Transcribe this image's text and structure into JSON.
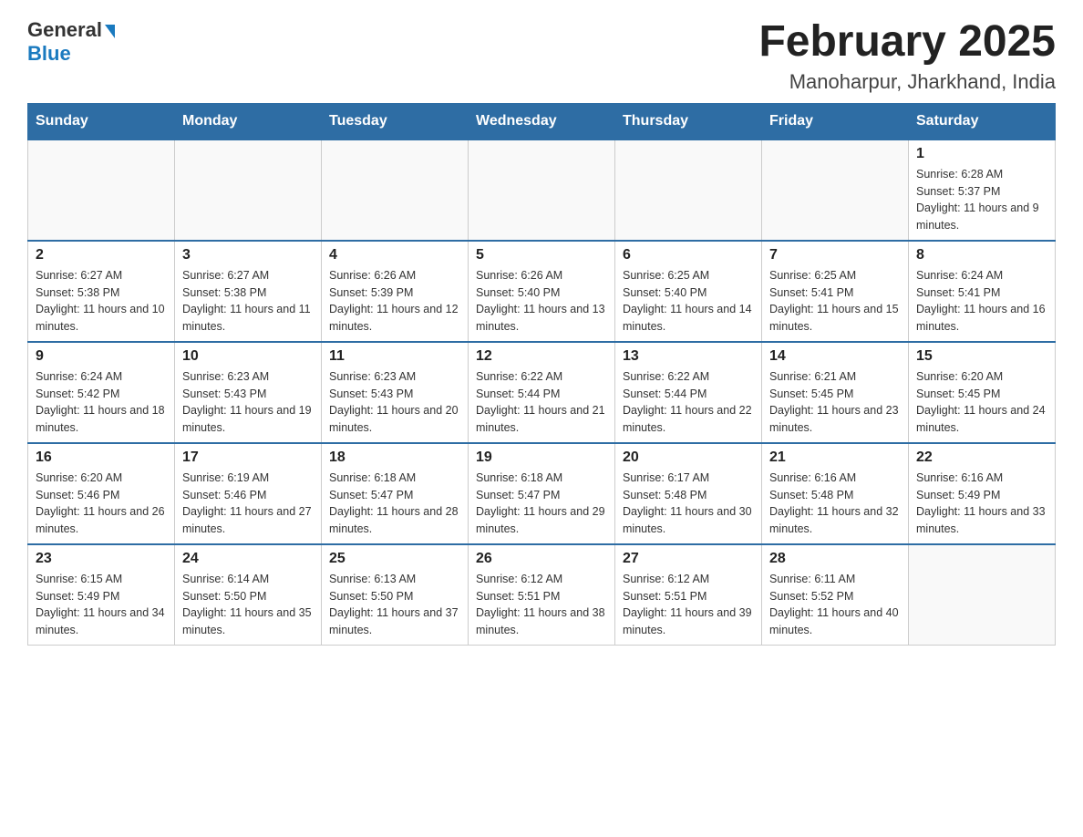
{
  "logo": {
    "general": "General",
    "blue": "Blue"
  },
  "title": "February 2025",
  "subtitle": "Manoharpur, Jharkhand, India",
  "days_of_week": [
    "Sunday",
    "Monday",
    "Tuesday",
    "Wednesday",
    "Thursday",
    "Friday",
    "Saturday"
  ],
  "weeks": [
    [
      {
        "day": "",
        "info": ""
      },
      {
        "day": "",
        "info": ""
      },
      {
        "day": "",
        "info": ""
      },
      {
        "day": "",
        "info": ""
      },
      {
        "day": "",
        "info": ""
      },
      {
        "day": "",
        "info": ""
      },
      {
        "day": "1",
        "info": "Sunrise: 6:28 AM\nSunset: 5:37 PM\nDaylight: 11 hours and 9 minutes."
      }
    ],
    [
      {
        "day": "2",
        "info": "Sunrise: 6:27 AM\nSunset: 5:38 PM\nDaylight: 11 hours and 10 minutes."
      },
      {
        "day": "3",
        "info": "Sunrise: 6:27 AM\nSunset: 5:38 PM\nDaylight: 11 hours and 11 minutes."
      },
      {
        "day": "4",
        "info": "Sunrise: 6:26 AM\nSunset: 5:39 PM\nDaylight: 11 hours and 12 minutes."
      },
      {
        "day": "5",
        "info": "Sunrise: 6:26 AM\nSunset: 5:40 PM\nDaylight: 11 hours and 13 minutes."
      },
      {
        "day": "6",
        "info": "Sunrise: 6:25 AM\nSunset: 5:40 PM\nDaylight: 11 hours and 14 minutes."
      },
      {
        "day": "7",
        "info": "Sunrise: 6:25 AM\nSunset: 5:41 PM\nDaylight: 11 hours and 15 minutes."
      },
      {
        "day": "8",
        "info": "Sunrise: 6:24 AM\nSunset: 5:41 PM\nDaylight: 11 hours and 16 minutes."
      }
    ],
    [
      {
        "day": "9",
        "info": "Sunrise: 6:24 AM\nSunset: 5:42 PM\nDaylight: 11 hours and 18 minutes."
      },
      {
        "day": "10",
        "info": "Sunrise: 6:23 AM\nSunset: 5:43 PM\nDaylight: 11 hours and 19 minutes."
      },
      {
        "day": "11",
        "info": "Sunrise: 6:23 AM\nSunset: 5:43 PM\nDaylight: 11 hours and 20 minutes."
      },
      {
        "day": "12",
        "info": "Sunrise: 6:22 AM\nSunset: 5:44 PM\nDaylight: 11 hours and 21 minutes."
      },
      {
        "day": "13",
        "info": "Sunrise: 6:22 AM\nSunset: 5:44 PM\nDaylight: 11 hours and 22 minutes."
      },
      {
        "day": "14",
        "info": "Sunrise: 6:21 AM\nSunset: 5:45 PM\nDaylight: 11 hours and 23 minutes."
      },
      {
        "day": "15",
        "info": "Sunrise: 6:20 AM\nSunset: 5:45 PM\nDaylight: 11 hours and 24 minutes."
      }
    ],
    [
      {
        "day": "16",
        "info": "Sunrise: 6:20 AM\nSunset: 5:46 PM\nDaylight: 11 hours and 26 minutes."
      },
      {
        "day": "17",
        "info": "Sunrise: 6:19 AM\nSunset: 5:46 PM\nDaylight: 11 hours and 27 minutes."
      },
      {
        "day": "18",
        "info": "Sunrise: 6:18 AM\nSunset: 5:47 PM\nDaylight: 11 hours and 28 minutes."
      },
      {
        "day": "19",
        "info": "Sunrise: 6:18 AM\nSunset: 5:47 PM\nDaylight: 11 hours and 29 minutes."
      },
      {
        "day": "20",
        "info": "Sunrise: 6:17 AM\nSunset: 5:48 PM\nDaylight: 11 hours and 30 minutes."
      },
      {
        "day": "21",
        "info": "Sunrise: 6:16 AM\nSunset: 5:48 PM\nDaylight: 11 hours and 32 minutes."
      },
      {
        "day": "22",
        "info": "Sunrise: 6:16 AM\nSunset: 5:49 PM\nDaylight: 11 hours and 33 minutes."
      }
    ],
    [
      {
        "day": "23",
        "info": "Sunrise: 6:15 AM\nSunset: 5:49 PM\nDaylight: 11 hours and 34 minutes."
      },
      {
        "day": "24",
        "info": "Sunrise: 6:14 AM\nSunset: 5:50 PM\nDaylight: 11 hours and 35 minutes."
      },
      {
        "day": "25",
        "info": "Sunrise: 6:13 AM\nSunset: 5:50 PM\nDaylight: 11 hours and 37 minutes."
      },
      {
        "day": "26",
        "info": "Sunrise: 6:12 AM\nSunset: 5:51 PM\nDaylight: 11 hours and 38 minutes."
      },
      {
        "day": "27",
        "info": "Sunrise: 6:12 AM\nSunset: 5:51 PM\nDaylight: 11 hours and 39 minutes."
      },
      {
        "day": "28",
        "info": "Sunrise: 6:11 AM\nSunset: 5:52 PM\nDaylight: 11 hours and 40 minutes."
      },
      {
        "day": "",
        "info": ""
      }
    ]
  ]
}
